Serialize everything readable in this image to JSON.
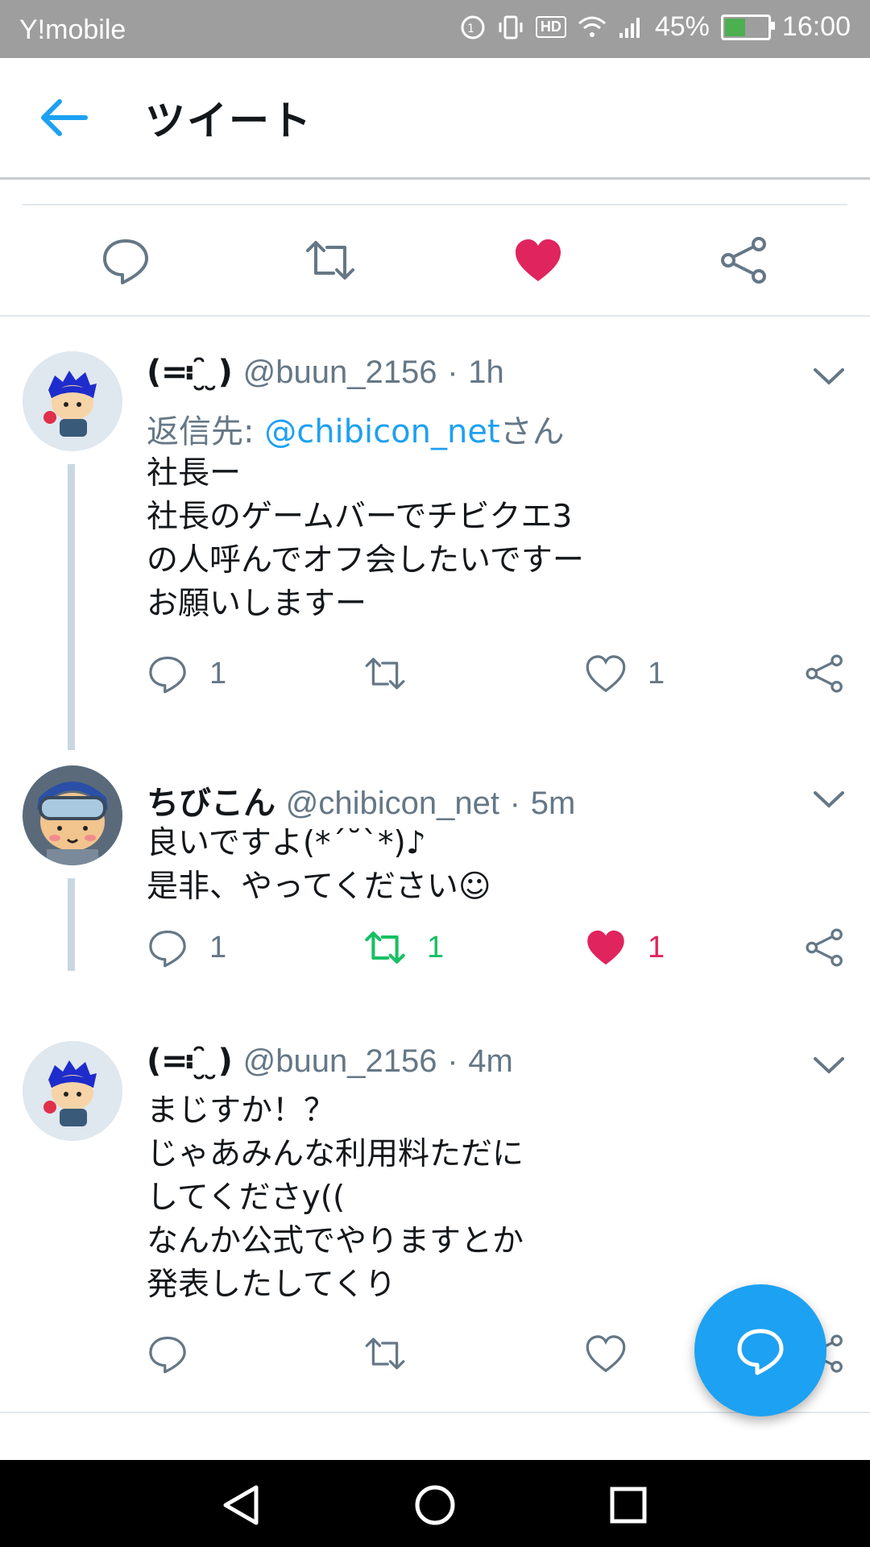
{
  "status_bar": {
    "carrier": "Y!mobile",
    "battery": "45%",
    "battery_level": 0.45,
    "hd": "HD",
    "time": "16:00"
  },
  "header": {
    "title": "ツイート"
  },
  "colors": {
    "accent": "#1da1f2",
    "like": "#e0245e",
    "retweet": "#17bf63",
    "muted": "#657786"
  },
  "tweets": [
    {
      "display_name": "(≕ ̮̑ ̮)",
      "handle": "@buun_2156",
      "time": "1h",
      "reply_prefix": "返信先: ",
      "reply_mention": "@chibicon_net",
      "reply_suffix": "さん",
      "text": "社長ー\n社長のゲームバーでチビクエ3\nの人呼んでオフ会したいですー\nお願いしますー",
      "replies": "1",
      "retweets": "",
      "likes": "1"
    },
    {
      "display_name": "ちびこん",
      "handle": "@chibicon_net",
      "time": "5m",
      "text": "良いですよ(*´˘`*)♪\n是非、やってください☺",
      "replies": "1",
      "retweets": "1",
      "likes": "1"
    },
    {
      "display_name": "(≕ ̮̑ ̮)",
      "handle": "@buun_2156",
      "time": "4m",
      "text": "まじすか！？\nじゃあみんな利用料ただに\nしてくださy((\nなんか公式でやりますとか\n発表したしてくり",
      "replies": "",
      "retweets": "",
      "likes": ""
    }
  ]
}
